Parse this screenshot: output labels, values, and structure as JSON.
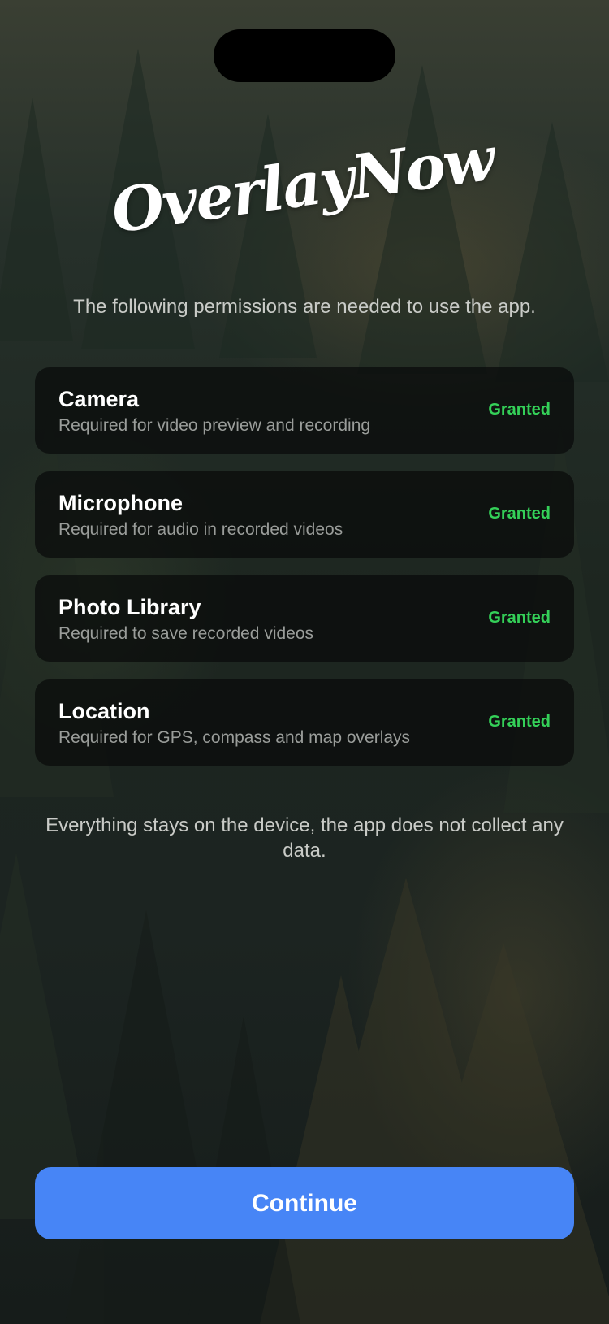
{
  "app": {
    "logo_text": "OverlayNow"
  },
  "intro_text": "The following permissions are needed to use the app.",
  "permissions": [
    {
      "title": "Camera",
      "description": "Required for video preview and recording",
      "status": "Granted"
    },
    {
      "title": "Microphone",
      "description": "Required for audio in recorded videos",
      "status": "Granted"
    },
    {
      "title": "Photo Library",
      "description": "Required to save recorded videos",
      "status": "Granted"
    },
    {
      "title": "Location",
      "description": "Required for GPS, compass and map overlays",
      "status": "Granted"
    }
  ],
  "footer_note": "Everything stays on the device, the app does not collect any data.",
  "continue_label": "Continue",
  "colors": {
    "accent": "#4785f6",
    "granted": "#34d058"
  }
}
